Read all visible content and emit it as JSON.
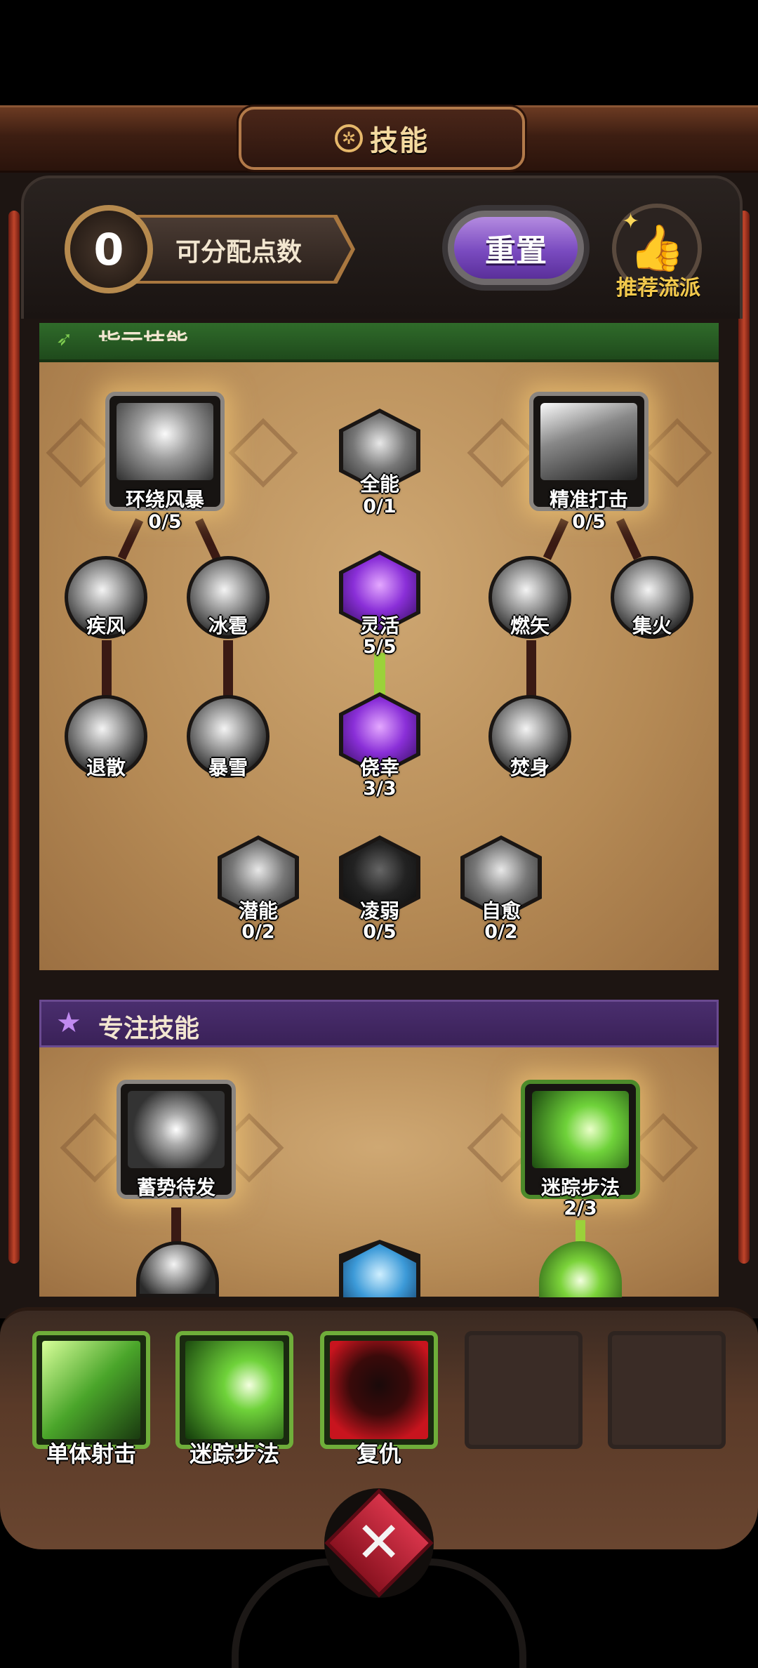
{
  "header": {
    "title": "技能",
    "icon": "gear-wheel-icon"
  },
  "points": {
    "value": "0",
    "label": "可分配点数"
  },
  "reset": {
    "label": "重置"
  },
  "recommend": {
    "label": "推荐流派",
    "icon": "thumbs-up-icon"
  },
  "section1": {
    "title": "指示技能",
    "icon": "boot-icon",
    "color": "#2f6b2a"
  },
  "section2": {
    "title": "专注技能",
    "icon": "star-icon",
    "color": "#4a2e6e"
  },
  "skills1": {
    "whirlwind": {
      "label": "环绕风暴",
      "count": "0/5"
    },
    "allround": {
      "label": "全能",
      "count": "0/1"
    },
    "precise": {
      "label": "精准打击",
      "count": "0/5"
    },
    "gale": {
      "label": "疾风"
    },
    "hail": {
      "label": "冰雹"
    },
    "agile": {
      "label": "灵活",
      "count": "5/5"
    },
    "ignite": {
      "label": "燃矢"
    },
    "focusfire": {
      "label": "集火"
    },
    "repel": {
      "label": "退散"
    },
    "blizzard": {
      "label": "暴雪"
    },
    "luck": {
      "label": "侥幸",
      "count": "3/3"
    },
    "burn": {
      "label": "焚身"
    },
    "potential": {
      "label": "潜能",
      "count": "0/2"
    },
    "weak": {
      "label": "凌弱",
      "count": "0/5"
    },
    "heal": {
      "label": "自愈",
      "count": "0/2"
    }
  },
  "skills2": {
    "charge": {
      "label": "蓄势待发"
    },
    "track": {
      "label": "迷踪步法",
      "count": "2/3"
    }
  },
  "slots": [
    {
      "label": "单体射击",
      "state": "filled"
    },
    {
      "label": "迷踪步法",
      "state": "filled"
    },
    {
      "label": "复仇",
      "state": "filled"
    },
    {
      "label": "",
      "state": "empty"
    },
    {
      "label": "",
      "state": "empty"
    }
  ],
  "close": {
    "icon": "close-x-icon"
  }
}
